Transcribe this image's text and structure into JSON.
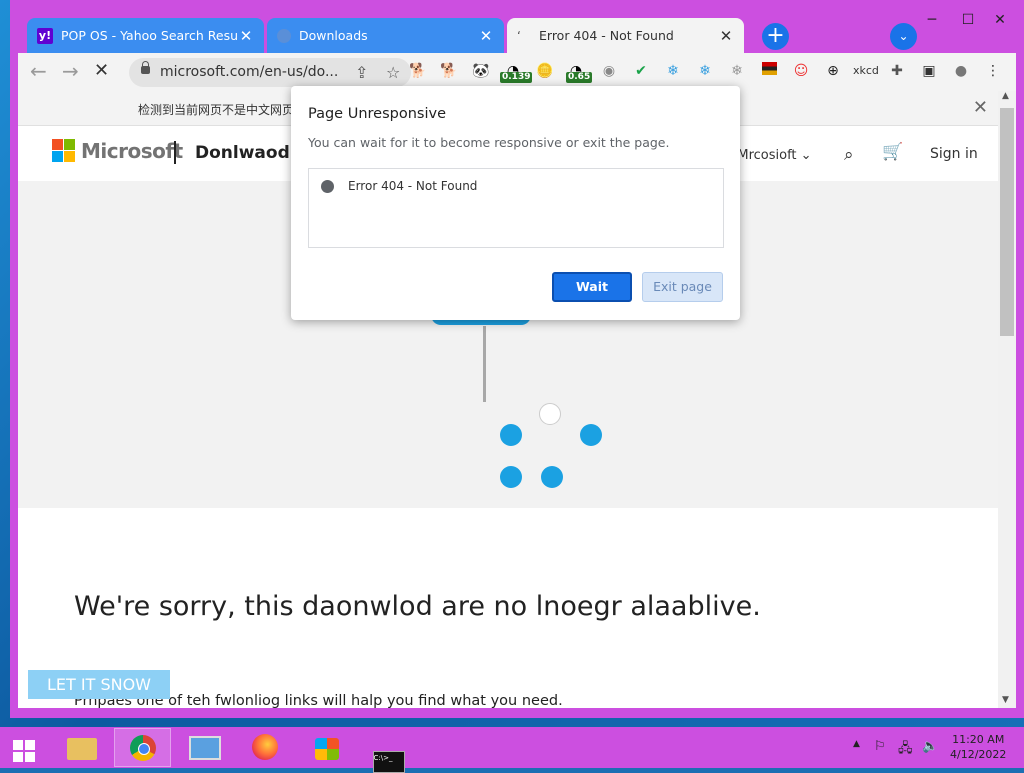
{
  "browser": {
    "tabs": [
      {
        "title": "POP OS - Yahoo Search Results",
        "icon": "yahoo-icon",
        "active": false
      },
      {
        "title": "Downloads",
        "icon": "downloads-icon",
        "active": false
      },
      {
        "title": "Error 404 - Not Found",
        "icon": "loading-icon",
        "active": true
      }
    ],
    "new_tab_label": "+",
    "address": "microsoft.com/en-us/do...",
    "extensions": [
      {
        "icon": "doge-icon"
      },
      {
        "icon": "doge-icon-2"
      },
      {
        "icon": "panda-icon"
      },
      {
        "icon": "gauge-icon",
        "badge": "0.139"
      },
      {
        "icon": "doge-coin-icon"
      },
      {
        "icon": "gauge-icon-2",
        "badge": "0.65"
      },
      {
        "icon": "disc-icon"
      },
      {
        "icon": "check-icon"
      },
      {
        "icon": "snowflake-icon"
      },
      {
        "icon": "snowflake-icon-2"
      },
      {
        "icon": "snowflake-icon-3"
      },
      {
        "icon": "flag-icon"
      },
      {
        "icon": "face-icon"
      },
      {
        "icon": "globe-dark-icon"
      },
      {
        "icon": "xkcd-icon",
        "label": "xkcd"
      },
      {
        "icon": "puzzle-icon"
      },
      {
        "icon": "sidepanel-icon"
      },
      {
        "icon": "profile-icon"
      },
      {
        "icon": "menu-icon"
      }
    ]
  },
  "translate_bar": {
    "message": "检测到当前网页不是中文网页"
  },
  "page": {
    "brand": "Microsoft",
    "page_name": "Donlwaod C",
    "all_microsoft": "ll Mrcosioft",
    "sign_in": "Sign in",
    "sorry_message": "We're sorry, this daonwlod are no lnoegr alaablive.",
    "sub_message": "Prhpaes one of teh fwlonliog links will halp you find what you need.",
    "snow_button": "LET IT SNOW"
  },
  "dialog": {
    "title": "Page Unresponsive",
    "subtitle": "You can wait for it to become responsive or exit the page.",
    "page_item": "Error 404 - Not Found",
    "wait_button": "Wait",
    "exit_button": "Exit page"
  },
  "taskbar": {
    "items": [
      {
        "icon": "start-icon"
      },
      {
        "icon": "file-explorer-icon"
      },
      {
        "icon": "chrome-icon",
        "active": true
      },
      {
        "icon": "control-panel-icon"
      },
      {
        "icon": "firefox-icon"
      },
      {
        "icon": "windows-media-icon"
      },
      {
        "icon": "cmd-icon"
      }
    ],
    "time": "11:20 AM",
    "date": "4/12/2022"
  },
  "colors": {
    "frame": "#cc4fe0",
    "accent": "#1a73e8",
    "spinner": "#1ba1e2"
  }
}
